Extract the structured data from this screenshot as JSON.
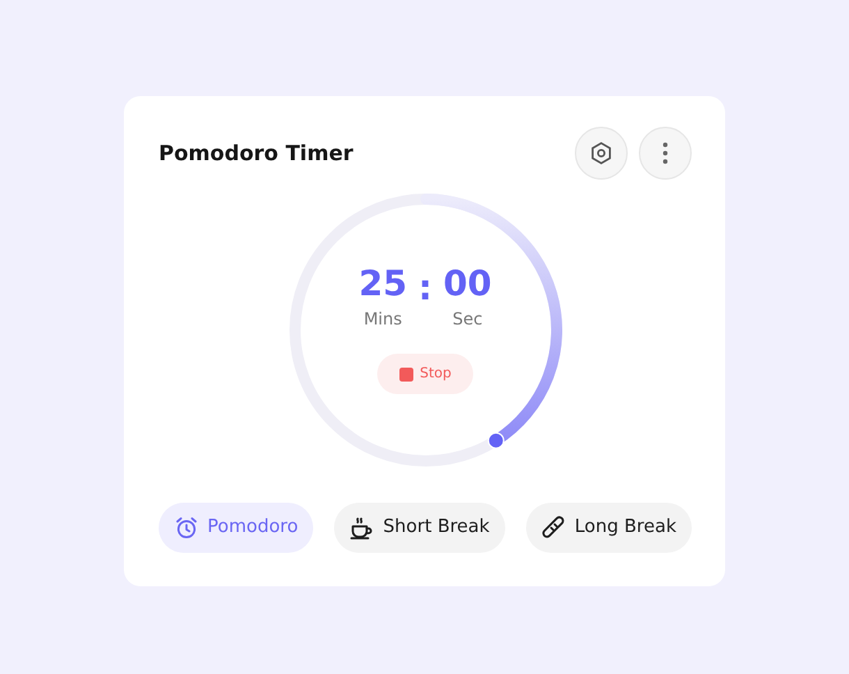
{
  "title": "Pomodoro Timer",
  "timer": {
    "minutes": "25",
    "separator": ":",
    "seconds": "00",
    "minutes_label": "Mins",
    "seconds_label": "Sec",
    "button": "Stop"
  },
  "modes": [
    {
      "label": "Pomodoro",
      "kind": "alarm",
      "selected": true
    },
    {
      "label": "Short Break",
      "kind": "coffee",
      "selected": false
    },
    {
      "label": "Long Break",
      "kind": "bread",
      "selected": false
    }
  ]
}
